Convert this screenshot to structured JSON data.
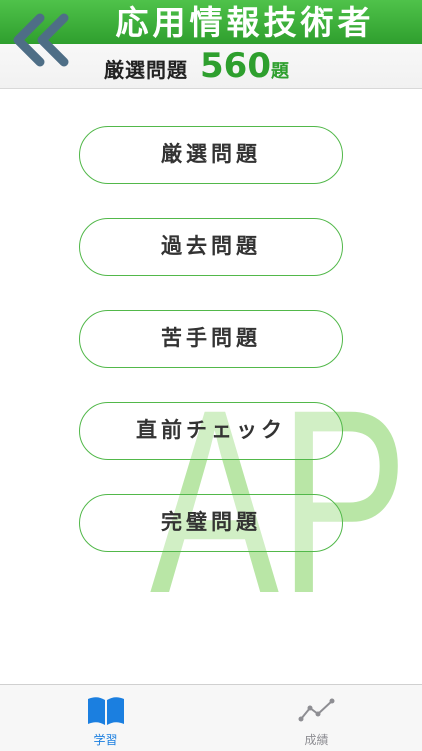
{
  "header": {
    "title": "応用情報技術者",
    "subtitle_label": "厳選問題",
    "count": "560",
    "unit": "題",
    "back_icon": "double-chevron-left-icon"
  },
  "watermark": {
    "text": "AP",
    "color": "#b9e6a6"
  },
  "menu": {
    "items": [
      {
        "label": "厳選問題"
      },
      {
        "label": "過去問題"
      },
      {
        "label": "苦手問題"
      },
      {
        "label": "直前チェック"
      },
      {
        "label": "完璧問題"
      }
    ]
  },
  "tabbar": {
    "tabs": [
      {
        "label": "学習",
        "icon": "book-icon",
        "active": true
      },
      {
        "label": "成績",
        "icon": "line-chart-icon",
        "active": false
      }
    ]
  },
  "colors": {
    "brand_green": "#3cae38",
    "active_tab": "#1b7fe0",
    "inactive_tab": "#8e8e93"
  }
}
